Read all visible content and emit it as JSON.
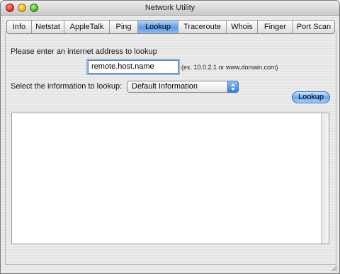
{
  "window": {
    "title": "Network Utility"
  },
  "tabs": [
    {
      "label": "Info"
    },
    {
      "label": "Netstat"
    },
    {
      "label": "AppleTalk"
    },
    {
      "label": "Ping"
    },
    {
      "label": "Lookup",
      "active": true
    },
    {
      "label": "Traceroute"
    },
    {
      "label": "Whois"
    },
    {
      "label": "Finger"
    },
    {
      "label": "Port Scan"
    }
  ],
  "lookup": {
    "address_prompt": "Please enter an internet address to lookup",
    "address_value": "remote.host.name",
    "address_hint": "(ex. 10.0.2.1 or www.domain.com)",
    "info_prompt": "Select the information to lookup:",
    "info_selected": "Default Information",
    "button_label": "Lookup"
  },
  "colors": {
    "active_tab": "#5d9ce6",
    "button": "#6aa8ec",
    "focus_ring": "#86b6ec"
  },
  "icons": [
    "close-button",
    "minimize-button",
    "zoom-button",
    "popup-arrows-icon",
    "resize-grip-icon"
  ]
}
